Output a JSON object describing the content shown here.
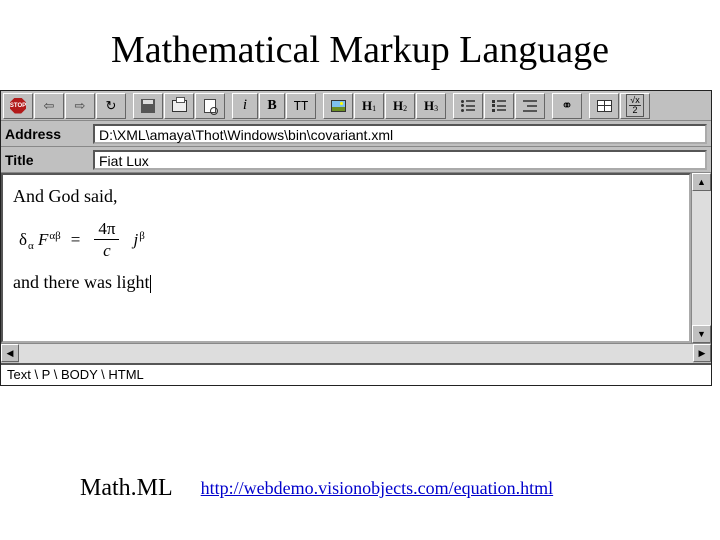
{
  "slide_title": "Mathematical Markup Language",
  "fields": {
    "address_label": "Address",
    "address_value": "D:\\XML\\amaya\\Thot\\Windows\\bin\\covariant.xml",
    "title_label": "Title",
    "title_value": "Fiat Lux"
  },
  "editor": {
    "line1": "And God said,",
    "line2": "and there was light",
    "equation": {
      "lhs_delta": "δ",
      "lhs_sub": "α",
      "lhs_F": "F",
      "lhs_sup": "αβ",
      "eq": "=",
      "frac_num": "4π",
      "frac_den": "c",
      "rhs_j": "j",
      "rhs_sup": "β"
    }
  },
  "status_path": "Text \\ P \\ BODY \\ HTML",
  "toolbar": {
    "stop": "STOP",
    "i": "i",
    "b": "B",
    "tt": "TT",
    "h1_h": "H",
    "h1_s": "1",
    "h2_h": "H",
    "h2_s": "2",
    "h3_h": "H",
    "h3_s": "3",
    "sqrt_top": "√x",
    "sqrt_bot": "2"
  },
  "footer": {
    "label": "Math.ML",
    "url": "http://webdemo.visionobjects.com/equation.html"
  }
}
